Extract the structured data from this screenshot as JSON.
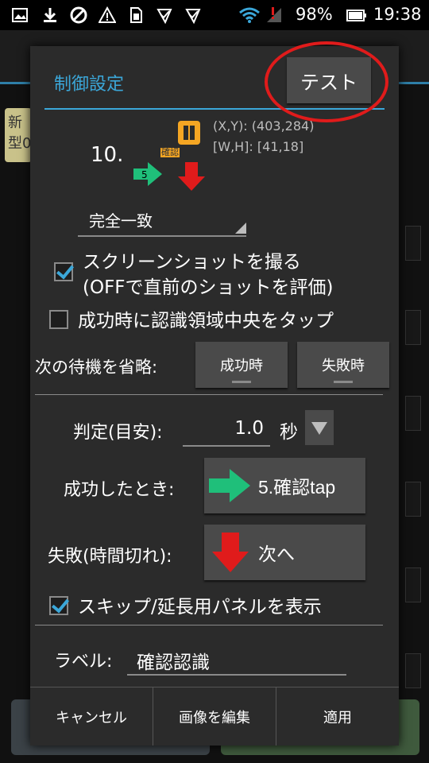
{
  "status_bar": {
    "battery": "98%",
    "time": "19:38",
    "icons": [
      "image-icon",
      "download-icon",
      "blocked-icon",
      "warning-icon",
      "sim-icon",
      "check-icon",
      "check-icon",
      "wifi-icon",
      "signal-icon",
      "battery-icon"
    ]
  },
  "background": {
    "chip_text": "新\n型0"
  },
  "dialog": {
    "title": "制御設定",
    "test_button": "テスト",
    "step_number": "10.",
    "step_badge": "5",
    "tag": "確認",
    "coords_xy": "(X,Y): (403,284)",
    "coords_wh": "[W,H]: [41,18]",
    "match_mode": "完全一致",
    "screenshot_label_1": "スクリーンショットを撮る",
    "screenshot_label_2": "(OFFで直前のショットを評価)",
    "screenshot_checked": true,
    "tap_center_label": "成功時に認識領域中央をタップ",
    "tap_center_checked": false,
    "skip_wait_label": "次の待機を省略:",
    "skip_success": "成功時",
    "skip_failure": "失敗時",
    "judge_label": "判定(目安):",
    "judge_value": "1.0",
    "judge_unit": "秒",
    "success_label": "成功したとき:",
    "success_action": "5.確認tap",
    "failure_label": "失敗(時間切れ):",
    "failure_action": "次へ",
    "skip_panel_label": "スキップ/延長用パネルを表示",
    "skip_panel_checked": true,
    "label_label": "ラベル:",
    "label_value": "確認認識",
    "footer": {
      "cancel": "キャンセル",
      "edit_image": "画像を編集",
      "apply": "適用"
    },
    "colors": {
      "accent": "#3ba7d9",
      "success_arrow": "#1fbf7a",
      "failure_arrow": "#e01b1b",
      "highlight": "#e01b1b"
    }
  }
}
